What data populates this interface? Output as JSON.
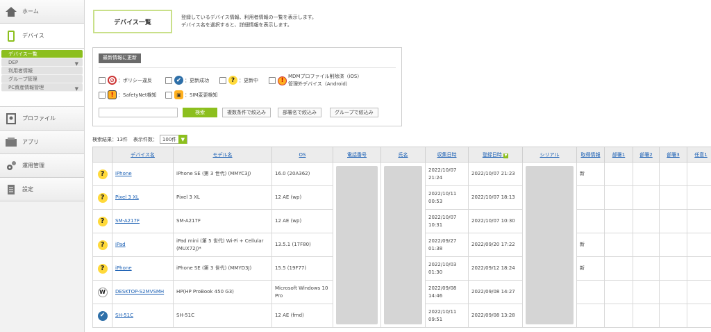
{
  "sidebar": {
    "home": "ホーム",
    "device": "デバイス",
    "subs": [
      "デバイス一覧",
      "DEP",
      "利用者情報",
      "グループ管理",
      "PC資産情報管理"
    ],
    "profile": "プロファイル",
    "app": "アプリ",
    "ops": "運用管理",
    "settings": "設定"
  },
  "page": {
    "title": "デバイス一覧",
    "desc1": "登録しているデバイス情報、利用者情報の一覧を表示します。",
    "desc2": "デバイス名を選択すると、詳細情報を表示します。"
  },
  "filter": {
    "refresh": "最新情報に更新",
    "policy": "：ポリシー違反",
    "success": "：更新成功",
    "updating": "：更新中",
    "mdm1": "MDMプロファイル削除済（iOS）",
    "mdm2": "管理外デバイス（Android）",
    "safetynet": "：SafetyNet検知",
    "sim": "：SIM変更検知",
    "search": "検索",
    "multi": "複数条件で絞込み",
    "dept": "部署名で絞込み",
    "group": "グループで絞込み"
  },
  "result": {
    "count": "検索結果：13件",
    "perpage_label": "表示件数：",
    "perpage": "100件"
  },
  "table": {
    "headers": [
      "デバイス名",
      "モデル名",
      "OS",
      "電話番号",
      "氏名",
      "収集日時",
      "登録日時",
      "シリアル",
      "取得情報",
      "部署1",
      "部署2",
      "部署3",
      "任意1"
    ],
    "rows": [
      {
        "icon": "?",
        "name": "iPhone",
        "model": "iPhone SE (第 3 世代) (MMYC3J)",
        "os": "16.0 (20A362)",
        "collected": "2022/10/07 21:24",
        "registered": "2022/10/07 21:23",
        "info": "新"
      },
      {
        "icon": "?",
        "name": "Pixel 3 XL",
        "model": "Pixel 3 XL",
        "os": "12 AE (wp)",
        "collected": "2022/10/11 00:53",
        "registered": "2022/10/07 18:13",
        "info": ""
      },
      {
        "icon": "?",
        "name": "SM-A217F",
        "model": "SM-A217F",
        "os": "12 AE (wp)",
        "collected": "2022/10/07 10:31",
        "registered": "2022/10/07 10:30",
        "info": ""
      },
      {
        "icon": "?",
        "name": "iPad",
        "model": "iPad mini (第 5 世代) Wi-Fi + Cellular (MUX72J)*",
        "os": "13.5.1 (17F80)",
        "collected": "2022/09/27 01:38",
        "registered": "2022/09/20 17:22",
        "info": "新"
      },
      {
        "icon": "?",
        "name": "iPhone",
        "model": "iPhone SE (第 3 世代) (MMYD3J)",
        "os": "15.5 (19F77)",
        "collected": "2022/10/03 01:30",
        "registered": "2022/09/12 18:24",
        "info": "新"
      },
      {
        "icon": "W",
        "name": "DESKTOP-S2MVSMH",
        "model": "HP(HP ProBook 450 G3)",
        "os": "Microsoft Windows 10 Pro",
        "collected": "2022/09/08 14:46",
        "registered": "2022/09/08 14:27",
        "info": ""
      },
      {
        "icon": "✔",
        "name": "SH-51C",
        "model": "SH-51C",
        "os": "12 AE (fmd)",
        "collected": "2022/10/11 09:51",
        "registered": "2022/09/08 13:28",
        "info": ""
      }
    ]
  }
}
